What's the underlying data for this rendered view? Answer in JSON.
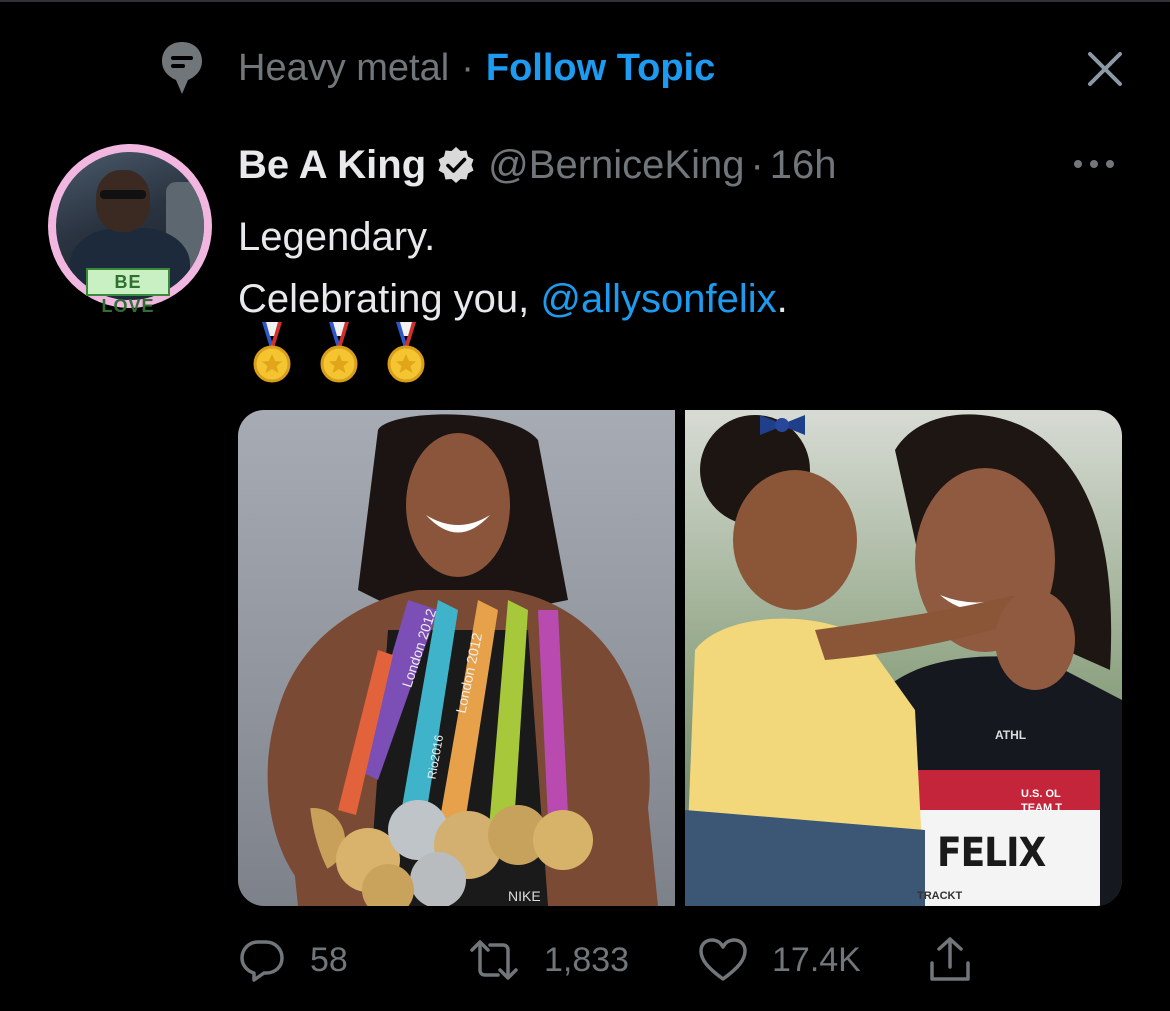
{
  "topic": {
    "name": "Heavy metal",
    "separator": "·",
    "follow_label": "Follow Topic"
  },
  "tweet": {
    "display_name": "Be A King",
    "handle": "@BerniceKing",
    "separator": "·",
    "time": "16h",
    "text_line1": "Legendary.",
    "text_line2_prefix": "Celebrating you, ",
    "mention": "@allysonfelix",
    "text_line2_suffix": ".",
    "medal_emoji_count": 3,
    "avatar_badge_text": "BE LOVE"
  },
  "media": {
    "left_photo_texts": [
      "London 2012",
      "London 2012",
      "Rio2016",
      "NIKE"
    ],
    "right_photo_texts": [
      "ATHL",
      "U.S. OL",
      "TEAM T",
      "FELIX",
      "TRACKT"
    ]
  },
  "actions": {
    "replies": "58",
    "retweets": "1,833",
    "likes": "17.4K"
  },
  "colors": {
    "background": "#000000",
    "accent": "#1d9bf0",
    "secondary_text": "#71767b",
    "primary_text": "#e7e9ea",
    "avatar_ring": "#f2b7e0"
  },
  "icons": [
    "topic-icon",
    "close-icon",
    "verified-badge-icon",
    "more-icon",
    "medal-icon",
    "reply-icon",
    "retweet-icon",
    "like-icon",
    "share-icon"
  ]
}
